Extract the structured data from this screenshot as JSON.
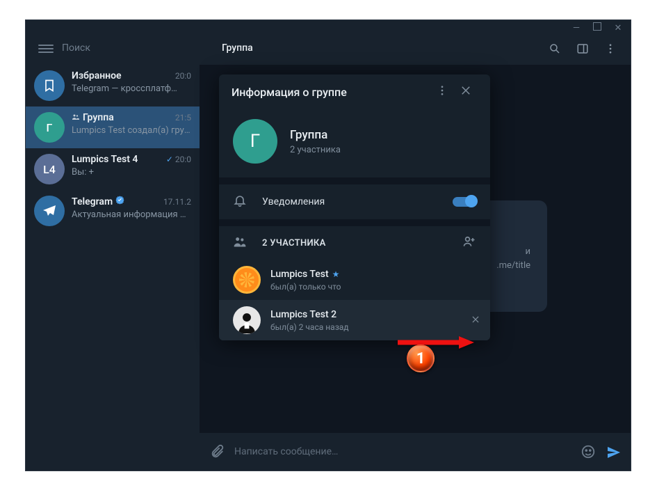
{
  "window": {
    "title": "Группа"
  },
  "search": {
    "placeholder": "Поиск"
  },
  "chats": [
    {
      "name": "Избранное",
      "subtitle": "Telegram — кроссплатф…",
      "time": "20:0",
      "icon": "bookmark"
    },
    {
      "name": "Группа",
      "subtitle": "Lumpics Test создал(а) групп…",
      "time": "21:5",
      "icon": "group",
      "active": true,
      "prefix": "group"
    },
    {
      "name": "Lumpics Test 4",
      "subtitle": "Вы: +",
      "time": "20:0",
      "icon": "L4",
      "read": true
    },
    {
      "name": "Telegram",
      "subtitle": "Актуальная информация о …",
      "time": "17.11.2",
      "icon": "telegram",
      "verified": true
    }
  ],
  "chat_header": {
    "title": "Группа"
  },
  "compose": {
    "placeholder": "Написать сообщение…"
  },
  "message_card": {
    "line1": "и",
    "line2": ".me/title"
  },
  "modal": {
    "title": "Информация о группе",
    "group_name": "Группа",
    "group_sub": "2 участника",
    "avatar_letter": "Г",
    "notifications_label": "Уведомления",
    "members_header": "2 УЧАСТНИКА",
    "members": [
      {
        "name": "Lumpics Test",
        "status": "был(а) только что",
        "owner": true
      },
      {
        "name": "Lumpics Test 2",
        "status": "был(а) 2 часа назад"
      }
    ]
  },
  "annotation": {
    "badge": "1"
  }
}
